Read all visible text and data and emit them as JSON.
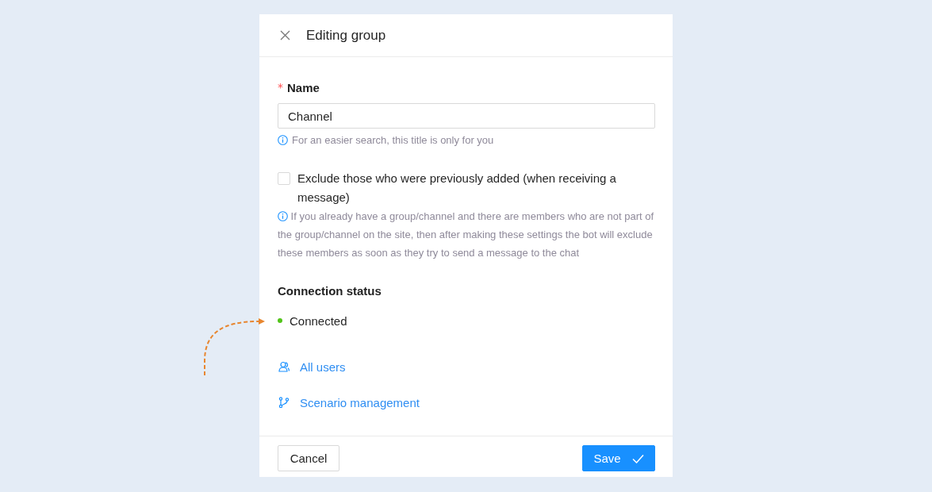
{
  "dialog": {
    "title": "Editing group"
  },
  "name_field": {
    "label": "Name",
    "required_mark": "*",
    "value": "Channel",
    "hint": "For an easier search, this title is only for you"
  },
  "exclude_option": {
    "label": "Exclude those who were previously added (when receiving a message)",
    "checked": false,
    "hint": "If you already have a group/channel and there are members who are not part of the group/channel on the site, then after making these settings the bot will exclude these members as soon as they try to send a message to the chat"
  },
  "connection": {
    "heading": "Connection status",
    "status": "Connected",
    "connected": true
  },
  "links": [
    {
      "kind": "users",
      "label": "All users"
    },
    {
      "kind": "branch",
      "label": "Scenario management"
    }
  ],
  "footer": {
    "buttons": [
      {
        "kind": "secondary",
        "label": "Cancel"
      },
      {
        "kind": "primary",
        "label": "Save"
      }
    ]
  }
}
